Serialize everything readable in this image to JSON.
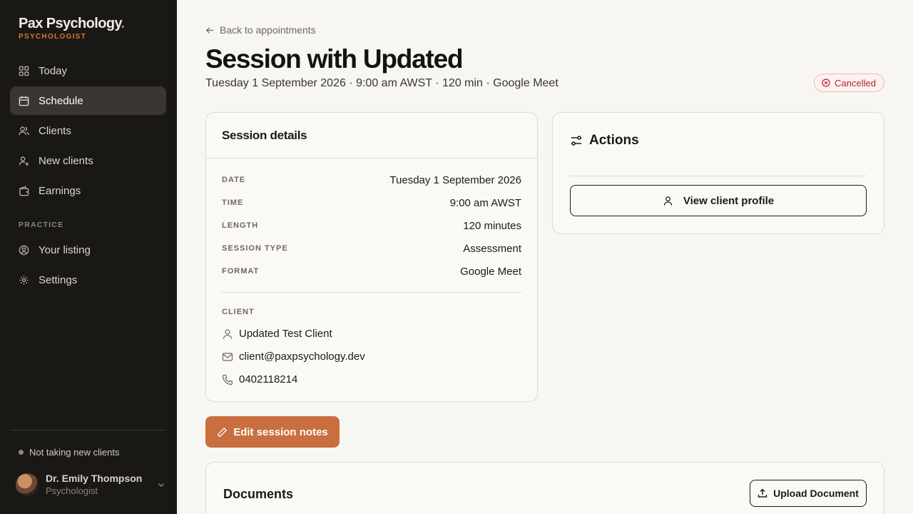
{
  "brand": {
    "name": "Pax Psychology",
    "dot": ".",
    "role": "PSYCHOLOGIST",
    "accent": "#d2763e"
  },
  "sidebar": {
    "items": [
      {
        "label": "Today",
        "icon": "grid-icon"
      },
      {
        "label": "Schedule",
        "icon": "calendar-icon",
        "active": true
      },
      {
        "label": "Clients",
        "icon": "users-icon"
      },
      {
        "label": "New clients",
        "icon": "user-plus-icon"
      },
      {
        "label": "Earnings",
        "icon": "wallet-icon"
      }
    ],
    "practice_label": "PRACTICE",
    "practice_items": [
      {
        "label": "Your listing",
        "icon": "user-circle-icon"
      },
      {
        "label": "Settings",
        "icon": "gear-icon"
      }
    ],
    "availability": "Not taking new clients",
    "user": {
      "name": "Dr. Emily Thompson",
      "role": "Psychologist"
    }
  },
  "header": {
    "back": "Back to appointments",
    "title": "Session with Updated",
    "subtitle": "Tuesday 1 September 2026 · 9:00 am AWST · 120 min · Google Meet",
    "status": "Cancelled",
    "status_color": "#b3262e"
  },
  "details": {
    "title": "Session details",
    "rows": [
      {
        "label": "DATE",
        "value": "Tuesday 1 September 2026"
      },
      {
        "label": "TIME",
        "value": "9:00 am AWST"
      },
      {
        "label": "LENGTH",
        "value": "120 minutes"
      },
      {
        "label": "SESSION TYPE",
        "value": "Assessment"
      },
      {
        "label": "FORMAT",
        "value": "Google Meet"
      }
    ],
    "client_label": "CLIENT",
    "client": {
      "name": "Updated Test Client",
      "email": "client@paxpsychology.dev",
      "phone": "0402118214"
    }
  },
  "actions": {
    "title": "Actions",
    "view_profile": "View client profile"
  },
  "edit_notes": "Edit session notes",
  "documents": {
    "title": "Documents",
    "upload": "Upload Document"
  }
}
